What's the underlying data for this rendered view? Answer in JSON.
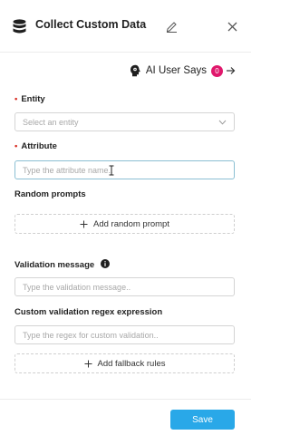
{
  "header": {
    "title": "Collect Custom Data",
    "icons": {
      "app": "database-icon",
      "edit": "pencil-icon",
      "close": "close-icon"
    }
  },
  "ai_user_says": {
    "label": "AI User Says",
    "count": "0",
    "icon": "ai-head-icon"
  },
  "entity": {
    "required_mark": "•",
    "label": "Entity",
    "placeholder": "Select an entity"
  },
  "attribute": {
    "required_mark": "•",
    "label": "Attribute",
    "placeholder": "Type the attribute name.."
  },
  "random_prompts": {
    "label": "Random prompts",
    "button_label": "Add random prompt"
  },
  "validation_message": {
    "label": "Validation message",
    "placeholder": "Type the validation message.."
  },
  "regex": {
    "label": "Custom validation regex expression",
    "placeholder": "Type the regex for custom validation.."
  },
  "fallback": {
    "button_label": "Add fallback rules"
  },
  "footer": {
    "save_label": "Save"
  },
  "colors": {
    "accent": "#29a8e8",
    "badge": "#e0186c",
    "required": "#d93025"
  }
}
